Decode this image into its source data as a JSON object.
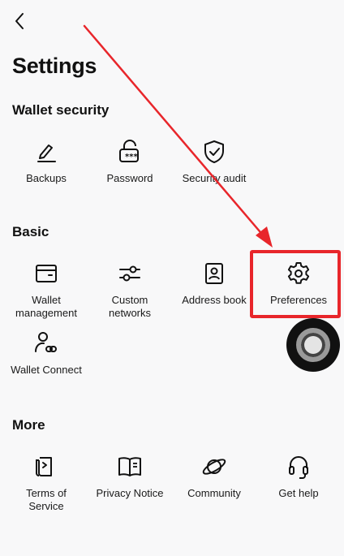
{
  "header": {
    "title": "Settings"
  },
  "wallet_security": {
    "title": "Wallet security",
    "items": [
      {
        "label": "Backups",
        "icon": "pencil-icon"
      },
      {
        "label": "Password",
        "icon": "lock-icon"
      },
      {
        "label": "Security audit",
        "icon": "shield-check-icon"
      }
    ]
  },
  "basic": {
    "title": "Basic",
    "items": [
      {
        "label": "Wallet\nmanagement",
        "icon": "wallet-icon"
      },
      {
        "label": "Custom\nnetworks",
        "icon": "sliders-icon"
      },
      {
        "label": "Address book",
        "icon": "address-book-icon"
      },
      {
        "label": "Preferences",
        "icon": "gear-icon"
      },
      {
        "label": "Wallet Connect",
        "icon": "wallet-connect-icon"
      }
    ]
  },
  "more": {
    "title": "More",
    "items": [
      {
        "label": "Terms of\nService",
        "icon": "document-icon"
      },
      {
        "label": "Privacy Notice",
        "icon": "book-icon"
      },
      {
        "label": "Community",
        "icon": "planet-icon"
      },
      {
        "label": "Get help",
        "icon": "headset-icon"
      }
    ]
  },
  "colors": {
    "highlight": "#e8262b",
    "text": "#111111",
    "background": "#f8f8f9"
  }
}
